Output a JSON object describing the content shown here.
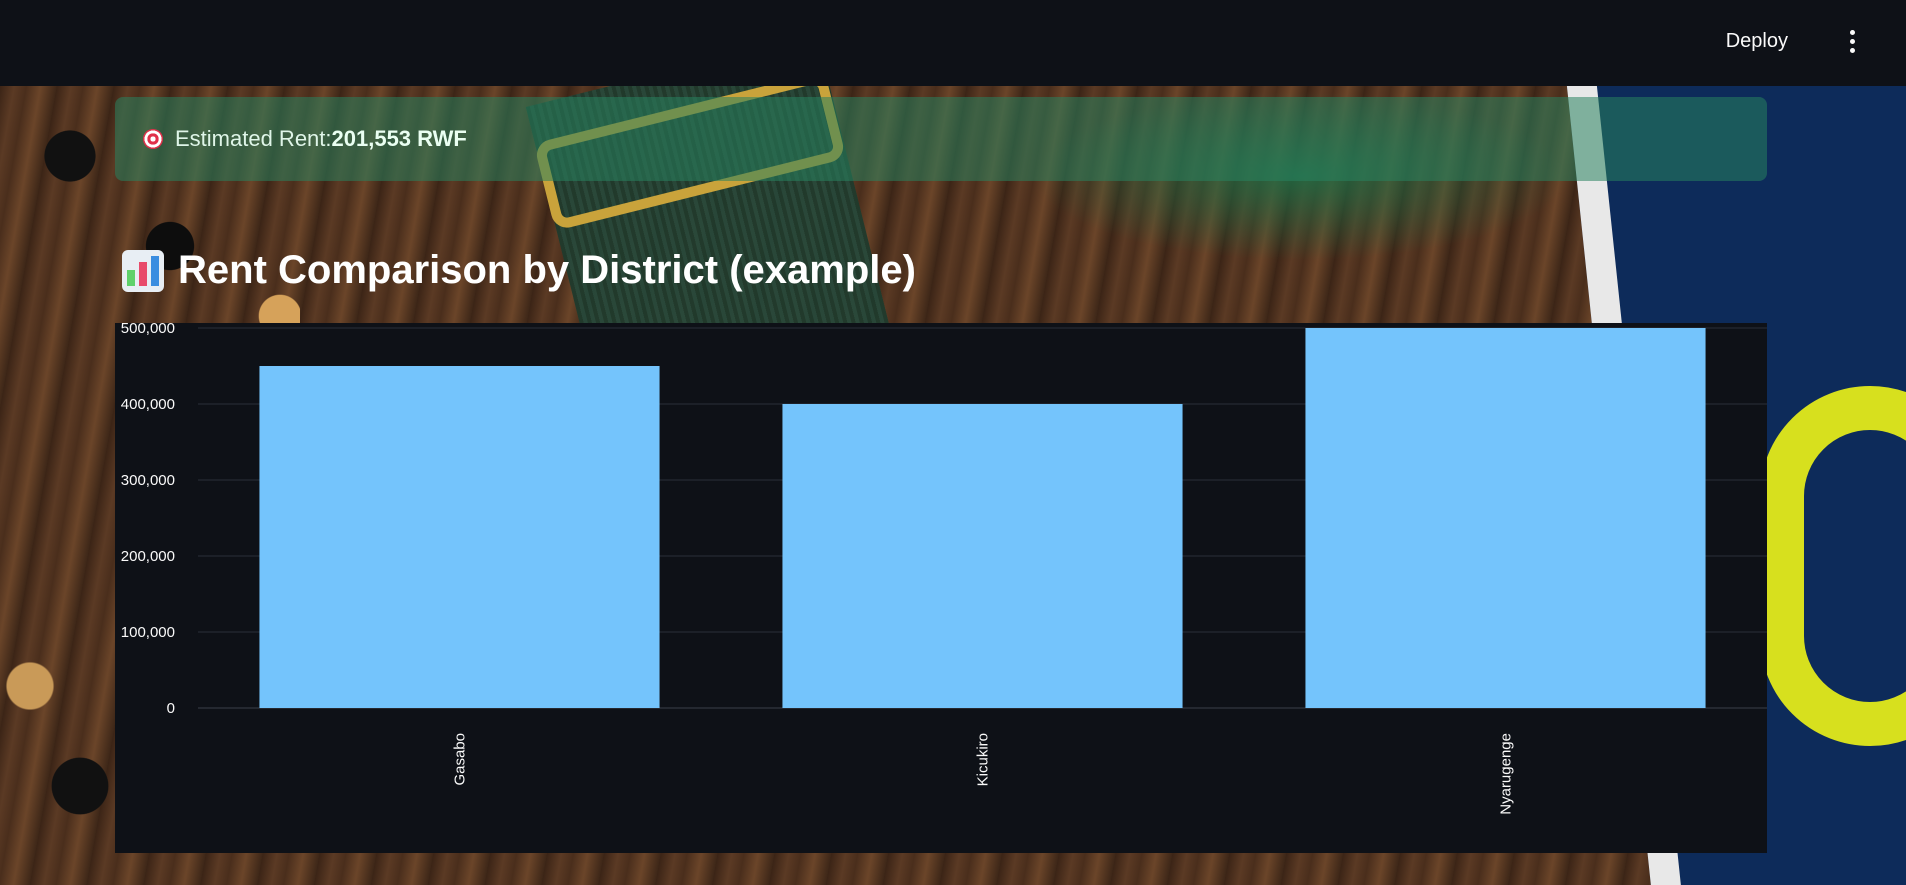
{
  "header": {
    "deploy_label": "Deploy",
    "menu_icon": "kebab-menu-icon"
  },
  "alert": {
    "icon": "target-icon",
    "prefix": "Estimated Rent: ",
    "value": "201,553 RWF",
    "color": "#28825f"
  },
  "section": {
    "icon": "bar-chart-icon",
    "title": "Rent Comparison by District (example)"
  },
  "chart_data": {
    "type": "bar",
    "categories": [
      "Gasabo",
      "Kicukiro",
      "Nyarugenge"
    ],
    "values": [
      450000,
      400000,
      500000
    ],
    "ylim": [
      0,
      500000
    ],
    "yticks": [
      0,
      100000,
      200000,
      300000,
      400000,
      500000
    ],
    "ytick_labels": [
      "0",
      "100,000",
      "200,000",
      "300,000",
      "400,000",
      "500,000"
    ],
    "bar_color": "#74c4fc",
    "grid": true,
    "xlabel": "",
    "ylabel": ""
  }
}
